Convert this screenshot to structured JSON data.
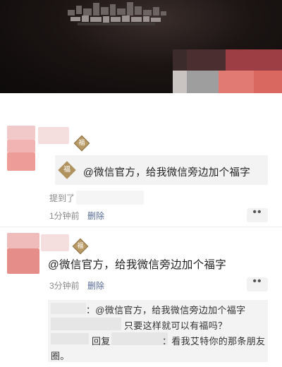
{
  "badge_char": "福",
  "moment1": {
    "quote": "@微信官方，给我微信旁边加个福字",
    "mention_label": "提到了",
    "time": "1分钟前",
    "delete_label": "删除",
    "more_label": "••"
  },
  "moment2": {
    "text": "@微信官方，给我微信旁边加个福字",
    "time": "3分钟前",
    "delete_label": "删除",
    "more_label": "••"
  },
  "comments": [
    {
      "text": "：@微信官方，给我微信旁边加个福字"
    },
    {
      "text": "只要这样就可以有福吗？"
    },
    {
      "reply_label": "回复",
      "text": "：看我艾特你的那条朋友"
    },
    {
      "text": "圈。"
    }
  ],
  "colors": {
    "link": "#576b95",
    "meta": "#8a8a8a",
    "badge": "#b89a66",
    "panel": "#f3f3f3"
  }
}
